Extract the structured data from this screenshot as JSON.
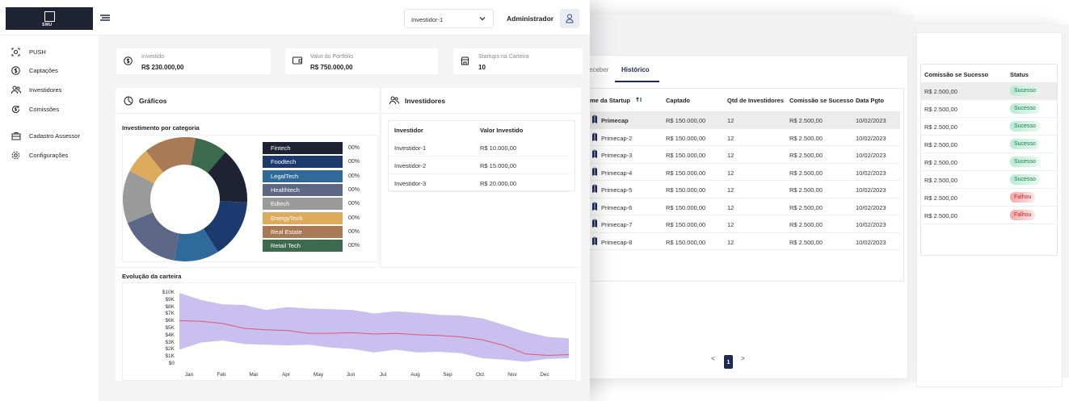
{
  "topbar": {
    "logo_text": "SMU",
    "investor_select": "Investidor-1",
    "admin_label": "Administrador"
  },
  "sidebar": {
    "items": [
      {
        "label": "PUSH",
        "icon": "push-icon"
      },
      {
        "label": "Captações",
        "icon": "dollar-icon"
      },
      {
        "label": "Investidores",
        "icon": "users-icon"
      },
      {
        "label": "Comissões",
        "icon": "commission-icon"
      },
      {
        "label": "Cadastro Assessor",
        "icon": "briefcase-icon"
      },
      {
        "label": "Configurações",
        "icon": "gear-icon"
      }
    ]
  },
  "stats": [
    {
      "label": "Investido",
      "value": "R$ 230.000,00",
      "icon": "dollar-icon"
    },
    {
      "label": "Valor do Portfólio",
      "value": "R$ 750.000,00",
      "icon": "wallet-icon"
    },
    {
      "label": "Startups na Carteira",
      "value": "10",
      "icon": "store-icon"
    }
  ],
  "graficos": {
    "title": "Gráficos",
    "category_title": "Investimento por categoria",
    "evolution_title": "Evolução da carteira"
  },
  "chart_data": [
    {
      "type": "pie",
      "title": "Investimento por categoria",
      "categories": [
        "Fintech",
        "Foodtech",
        "LegalTech",
        "Healthtech",
        "Edtech",
        "EnergyTech",
        "Real Estate",
        "Retail Tech"
      ],
      "percent_labels": [
        "00%",
        "00%",
        "00%",
        "00%",
        "00%",
        "00%",
        "00%",
        "00%"
      ],
      "slice_shares": [
        0.258,
        0.153,
        0.117,
        0.16,
        0.138,
        0.066,
        0.136,
        0.085
      ],
      "colors": [
        "#1e2233",
        "#1d3a6e",
        "#2f6a9a",
        "#5b6785",
        "#9a9a9a",
        "#deaa5c",
        "#a87a55",
        "#3c6a4e"
      ]
    },
    {
      "type": "area",
      "title": "Evolução da carteira",
      "x_ticks": [
        "Jan",
        "Feb",
        "Mar",
        "Apr",
        "May",
        "Jun",
        "Jul",
        "Aug",
        "Sep",
        "Oct",
        "Nov",
        "Dec"
      ],
      "y_ticks": [
        "$10K",
        "$9K",
        "$8K",
        "$7K",
        "$6K",
        "$5K",
        "$4K",
        "$3K",
        "$2K",
        "$1K",
        "$0"
      ],
      "ylim": [
        0,
        10000
      ],
      "mid_line": [
        6100,
        6000,
        5700,
        5000,
        4800,
        4700,
        4300,
        4300,
        4400,
        4200,
        4300,
        4100,
        4000,
        3800,
        3400,
        2600,
        1400,
        1200,
        1300
      ],
      "band_high": [
        10000,
        9000,
        8400,
        8300,
        7600,
        8000,
        7800,
        7700,
        7600,
        7100,
        7400,
        7200,
        6900,
        6800,
        6400,
        5500,
        4500,
        3800,
        3600
      ],
      "band_low": [
        2000,
        3000,
        3300,
        2800,
        2700,
        2600,
        2700,
        2300,
        2100,
        1600,
        2000,
        1600,
        1700,
        1500,
        800,
        600,
        300,
        700,
        800
      ],
      "colors": {
        "band": "#c9c0f0",
        "line": "#e0557a"
      }
    }
  ],
  "investidores": {
    "title": "Investidores",
    "headers": [
      "Investidor",
      "Valor Investido"
    ],
    "rows": [
      [
        "Investidor-1",
        "R$ 10.000,00"
      ],
      [
        "Investidor-2",
        "R$ 15.000,00"
      ],
      [
        "Investidor-3",
        "R$ 20.000,00"
      ]
    ]
  },
  "historico": {
    "tab_inactive": "eceber",
    "tab_active": "Histórico",
    "headers": [
      "me da Startup",
      "Captado",
      "Qtd de Investidores",
      "Comissão se Sucesso",
      "Data Pgto"
    ],
    "rows": [
      [
        "Primecap",
        "R$ 150.000,00",
        "12",
        "R$ 2.500,00",
        "10/02/2023"
      ],
      [
        "Primecap-2",
        "R$ 150.000,00",
        "12",
        "R$ 2.500,00",
        "10/02/2023"
      ],
      [
        "Primecap-3",
        "R$ 150.000,00",
        "12",
        "R$ 2.500,00",
        "10/02/2023"
      ],
      [
        "Primecap-4",
        "R$ 150.000,00",
        "12",
        "R$ 2.500,00",
        "10/02/2023"
      ],
      [
        "Primecap-5",
        "R$ 150.000,00",
        "12",
        "R$ 2.500,00",
        "10/02/2023"
      ],
      [
        "Primecap-6",
        "R$ 150.000,00",
        "12",
        "R$ 2.500,00",
        "10/02/2023"
      ],
      [
        "Primecap-7",
        "R$ 150.000,00",
        "12",
        "R$ 2.500,00",
        "10/02/2023"
      ],
      [
        "Primecap-8",
        "R$ 150.000,00",
        "12",
        "R$ 2.500,00",
        "10/02/2023"
      ]
    ],
    "pager": {
      "prev": "<",
      "page": "1",
      "next": ">"
    }
  },
  "status_panel": {
    "headers": [
      "Comissão se Sucesso",
      "Status"
    ],
    "rows": [
      [
        "R$ 2.500,00",
        "Sucesso"
      ],
      [
        "R$ 2.500,00",
        "Sucesso"
      ],
      [
        "R$ 2.500,00",
        "Sucesso"
      ],
      [
        "R$ 2.500,00",
        "Sucesso"
      ],
      [
        "R$ 2.500,00",
        "Sucesso"
      ],
      [
        "R$ 2.500,00",
        "Sucesso"
      ],
      [
        "R$ 2.500,00",
        "Falhou"
      ],
      [
        "R$ 2.500,00",
        "Falhou"
      ]
    ],
    "colors": {
      "success": "#1b7a4a",
      "fail": "#c42424"
    }
  }
}
